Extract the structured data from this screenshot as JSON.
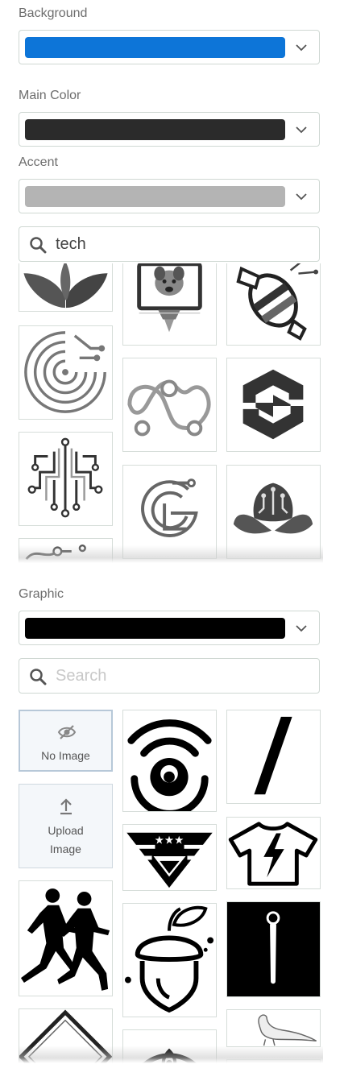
{
  "background": {
    "label": "Background",
    "color": "#0d75d8"
  },
  "main_color": {
    "label": "Main Color",
    "color": "#2b2b2b"
  },
  "accent": {
    "label": "Accent",
    "color": "#b4b4b4"
  },
  "icon_search": {
    "value": "tech",
    "placeholder": ""
  },
  "icon_results": [
    "sprout-icon",
    "monitor-dog-icon",
    "robot-bee-icon",
    "circuit-maze-icon",
    "infinity-loop-icon",
    "hexagon-s-icon",
    "circuit-tree-icon",
    "g-circuit-icon",
    "lotus-circuit-icon",
    "circuit-dots-icon"
  ],
  "graphic": {
    "label": "Graphic",
    "color": "#000000"
  },
  "graphic_search": {
    "value": "",
    "placeholder": "Search"
  },
  "graphic_tiles": {
    "no_image": "No Image",
    "upload_line1": "Upload",
    "upload_line2": "Image",
    "items": [
      "wifi-face-icon",
      "slash-icon",
      "triangle-stars-icon",
      "tshirt-bolt-icon",
      "runners-icon",
      "acorn-icon",
      "exclamation-icon",
      "diamond-frame-icon",
      "pheasant-icon",
      "eye-circle-icon"
    ]
  }
}
